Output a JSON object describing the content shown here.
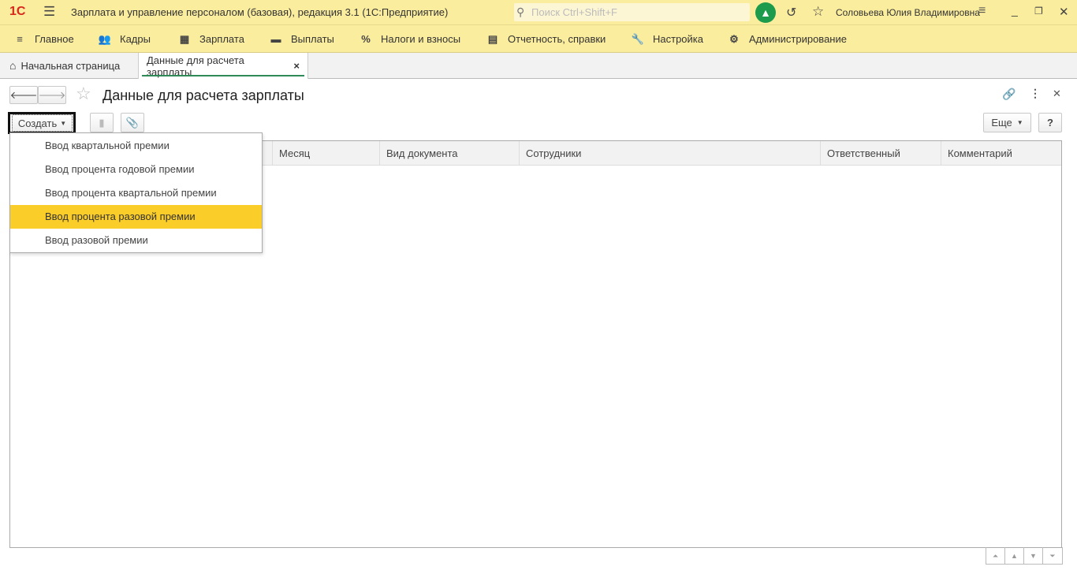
{
  "app": {
    "logo": "1С",
    "title": "Зарплата и управление персоналом (базовая), редакция 3.1  (1С:Предприятие)",
    "search_placeholder": "Поиск Ctrl+Shift+F",
    "user": "Соловьева Юлия Владимировна"
  },
  "sections": [
    {
      "label": "Главное",
      "icon": "menu-icon"
    },
    {
      "label": "Кадры",
      "icon": "people-icon"
    },
    {
      "label": "Зарплата",
      "icon": "calculator-icon"
    },
    {
      "label": "Выплаты",
      "icon": "wallet-icon"
    },
    {
      "label": "Налоги и взносы",
      "icon": "percent-icon"
    },
    {
      "label": "Отчетность, справки",
      "icon": "reports-icon"
    },
    {
      "label": "Настройка",
      "icon": "wrench-icon"
    },
    {
      "label": "Администрирование",
      "icon": "gear-icon"
    }
  ],
  "tabs": [
    {
      "label": "Начальная страница"
    },
    {
      "label": "Данные для расчета зарплаты",
      "close": "×"
    }
  ],
  "form": {
    "title": "Данные для расчета зарплаты",
    "create_label": "Создать",
    "more_label": "Еще",
    "help_label": "?"
  },
  "table": {
    "columns": [
      "",
      "Месяц",
      "Вид документа",
      "Сотрудники",
      "Ответственный",
      "Комментарий"
    ]
  },
  "create_menu": {
    "items": [
      "Ввод квартальной премии",
      "Ввод процента годовой премии",
      "Ввод процента квартальной премии",
      "Ввод процента разовой премии",
      "Ввод разовой премии"
    ],
    "selected_index": 3
  },
  "colors": {
    "accent": "#fbcd28",
    "panel": "#fbed9e",
    "bell": "#1b9b4b"
  }
}
